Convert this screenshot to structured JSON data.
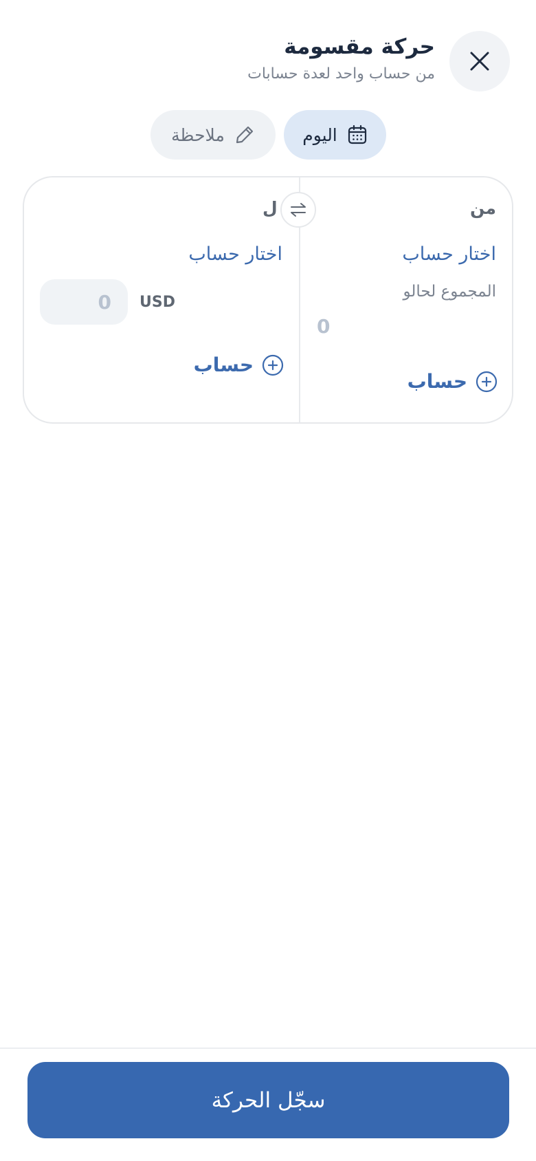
{
  "header": {
    "title": "حركة مقسومة",
    "subtitle": "من حساب واحد لعدة حسابات"
  },
  "chips": {
    "date_label": "اليوم",
    "note_label": "ملاحظة"
  },
  "from": {
    "label": "من",
    "select_label": "اختار حساب",
    "total_label": "المجموع لحالو",
    "total_value": "0",
    "add_account_label": "حساب"
  },
  "to": {
    "label": "ل",
    "select_label": "اختار حساب",
    "currency": "USD",
    "amount_placeholder": "0",
    "add_account_label": "حساب"
  },
  "footer": {
    "submit_label": "سجّل الحركة"
  },
  "icons": {
    "close": "close-icon",
    "date": "calendar-icon",
    "note": "pencil-icon",
    "swap": "swap-icon",
    "add": "plus-circle-icon"
  },
  "colors": {
    "primary": "#3768b0",
    "link": "#3c6aae",
    "date_chip_bg": "#dde8f6",
    "note_chip_bg": "#eff2f5",
    "title": "#1d2a3f"
  }
}
